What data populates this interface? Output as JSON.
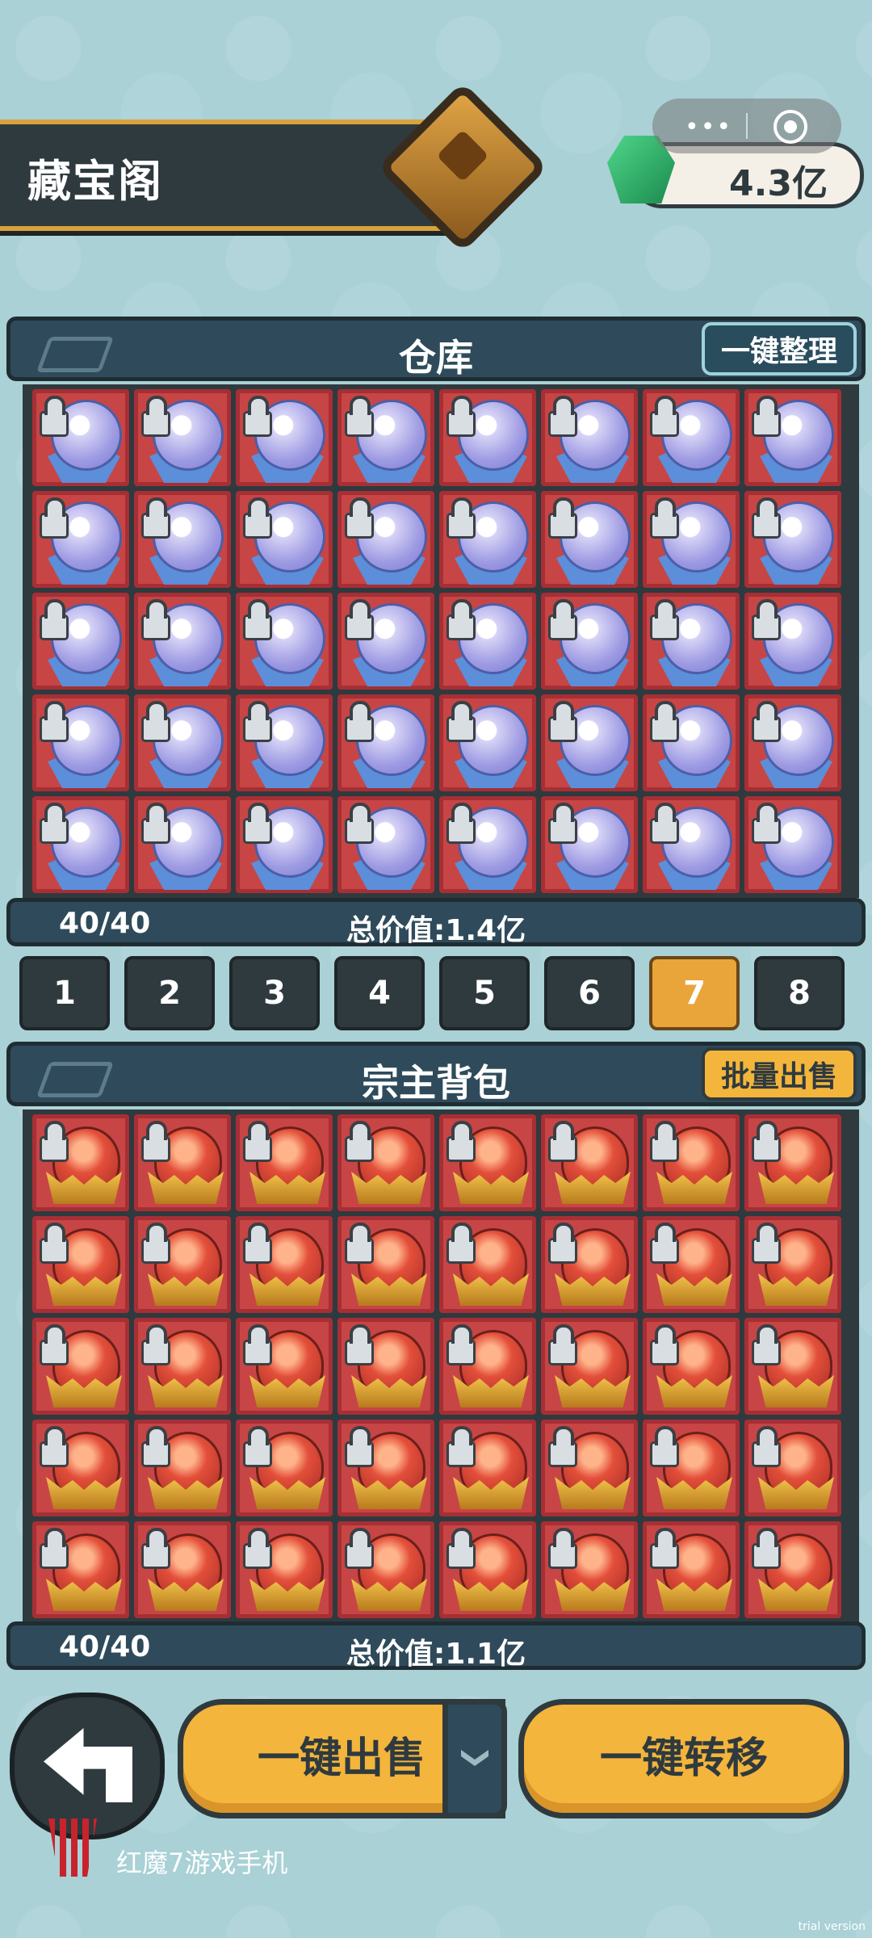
{
  "header": {
    "title": "藏宝阁",
    "currency_value": "4.3亿",
    "capsule_menu": "•••"
  },
  "warehouse": {
    "title": "仓库",
    "action_button": "一键整理",
    "count": "40/40",
    "total": "总价值:1.4亿",
    "item_icon": "spirit-orb-icon",
    "rows": 5,
    "cols": 8
  },
  "tabs": {
    "labels": [
      "1",
      "2",
      "3",
      "4",
      "5",
      "6",
      "7",
      "8"
    ],
    "active": "7"
  },
  "backpack": {
    "title": "宗主背包",
    "action_button": "批量出售",
    "count": "40/40",
    "total": "总价值:1.1亿",
    "item_icon": "fire-gourd-icon",
    "rows": 5,
    "cols": 8
  },
  "bottom": {
    "sell_all": "一键出售",
    "transfer_all": "一键转移"
  },
  "watermark": "红魔7游戏手机",
  "trial_label": "trial version",
  "colors": {
    "background": "#a9d1d6",
    "panel": "#2f4b5b",
    "cell": "#c84545",
    "accent_gold": "#f3b53b",
    "active_tab": "#e9a43a"
  }
}
